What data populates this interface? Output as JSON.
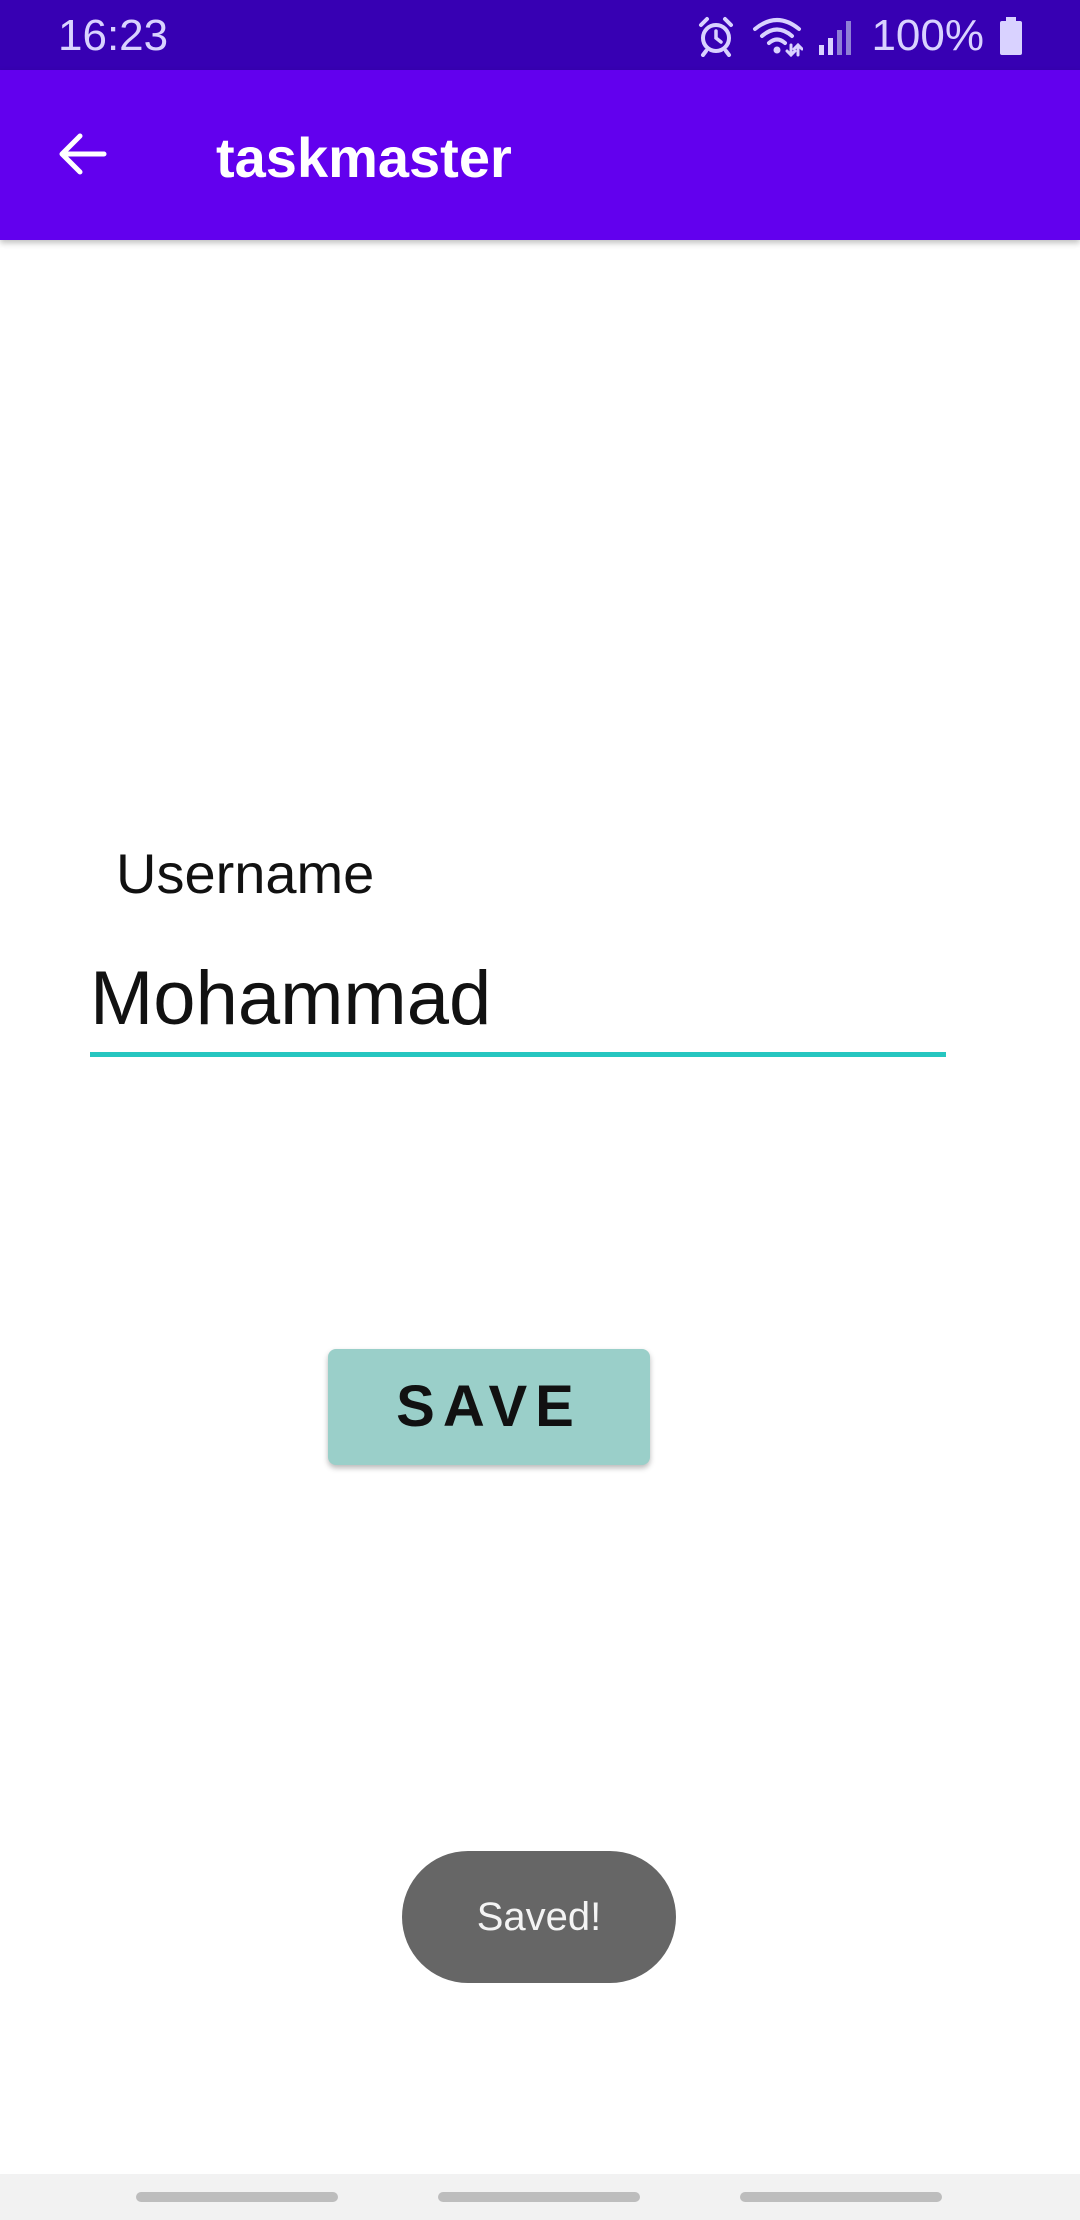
{
  "status_bar": {
    "time": "16:23",
    "battery_percent": "100%",
    "icons": [
      "alarm-icon",
      "wifi-icon",
      "signal-icon",
      "battery-icon"
    ],
    "background": "#3700b3"
  },
  "app_bar": {
    "title": "taskmaster",
    "back_icon": "arrow-back-icon",
    "background": "#6200ee"
  },
  "form": {
    "username_label": "Username",
    "username_value": "Mohammad",
    "underline_color": "#26c6c0"
  },
  "save_button": {
    "label": "SAVE",
    "background": "#9acfc9"
  },
  "toast": {
    "message": "Saved!"
  },
  "nav_bar": {
    "handles": 3
  }
}
